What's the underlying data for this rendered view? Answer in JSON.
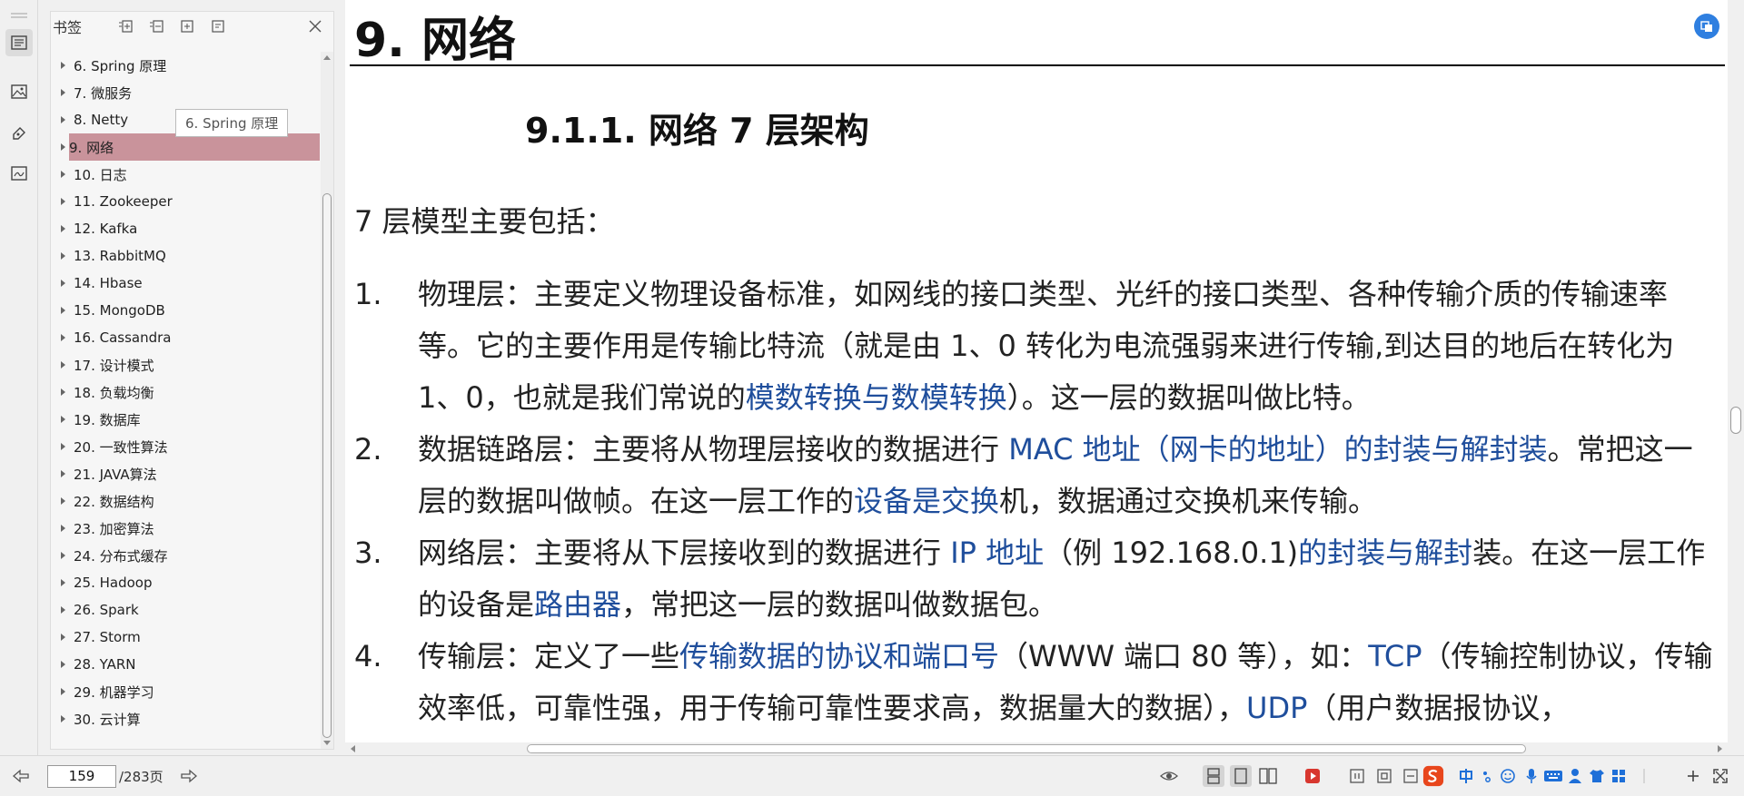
{
  "bookmarks": {
    "title": "书签",
    "tooltip": "6. Spring 原理",
    "items": [
      {
        "label": "6. Spring 原理"
      },
      {
        "label": "7.   微服务"
      },
      {
        "label": "8. Netty"
      },
      {
        "label": "9. 网络"
      },
      {
        "label": "10. 日志"
      },
      {
        "label": "11. Zookeeper"
      },
      {
        "label": "12. Kafka"
      },
      {
        "label": "13. RabbitMQ"
      },
      {
        "label": "14. Hbase"
      },
      {
        "label": "15. MongoDB"
      },
      {
        "label": "16. Cassandra"
      },
      {
        "label": "17. 设计模式"
      },
      {
        "label": "18. 负载均衡"
      },
      {
        "label": "19. 数据库"
      },
      {
        "label": "20. 一致性算法"
      },
      {
        "label": "21. JAVA算法"
      },
      {
        "label": "22. 数据结构"
      },
      {
        "label": "23. 加密算法"
      },
      {
        "label": "24. 分布式缓存"
      },
      {
        "label": "25. Hadoop"
      },
      {
        "label": "26. Spark"
      },
      {
        "label": "27. Storm"
      },
      {
        "label": "28. YARN"
      },
      {
        "label": "29. 机器学习"
      },
      {
        "label": "30. 云计算"
      }
    ],
    "selected_index": 3
  },
  "document": {
    "heading": "9. 网络",
    "subheading": "9.1.1.  网络 7 层架构",
    "intro": "7 层模型主要包括：",
    "list": [
      {
        "num": "1.",
        "t1": "物理层：主要定义物理设备标准，如网线的接口类型、光纤的接口类型、各种传输介质的传输速率等。它的主要作用是传输比特流（就是由 1、0 转化为电流强弱来进行传输,到达目的地后在转化为 1、0，也就是我们常说的",
        "l1": "模数转换与数模转换",
        "t2": "）。这一层的数据叫做比特。"
      },
      {
        "num": "2.",
        "t1": "数据链路层：主要将从物理层接收的数据进行 ",
        "l1": "MAC 地址（网卡的地址）的封装与解封装",
        "t2": "。常把这一层的数据叫做帧。在这一层工作的",
        "l2": "设备是交换",
        "t3": "机，数据通过交换机来传输。"
      },
      {
        "num": "3.",
        "t1": "网络层：主要将从下层接收到的数据进行 ",
        "l1": "IP 地址",
        "t2": "（例 192.168.0.1)",
        "l2": "的封装与解封",
        "t3": "装。在这一层工作的设备是",
        "l3": "路由器",
        "t4": "，常把这一层的数据叫做数据包。"
      },
      {
        "num": "4.",
        "t1": "传输层：定义了一些",
        "l1": "传输数据的协议和端口号",
        "t2": "（WWW 端口 80 等），如：",
        "l2": "TCP",
        "t3": "（传输控制协议，传输效率低，可靠性强，用于传输可靠性要求高，数据量大的数据），",
        "l3": "UDP",
        "t4": "（用户数据报协议，"
      }
    ]
  },
  "pager": {
    "current": "159",
    "total": "/283页"
  },
  "colors": {
    "link": "#1f4e9c",
    "selected": "#c9939b",
    "ime_accent": "#e8461c",
    "ime_blue": "#1e6fd8"
  }
}
